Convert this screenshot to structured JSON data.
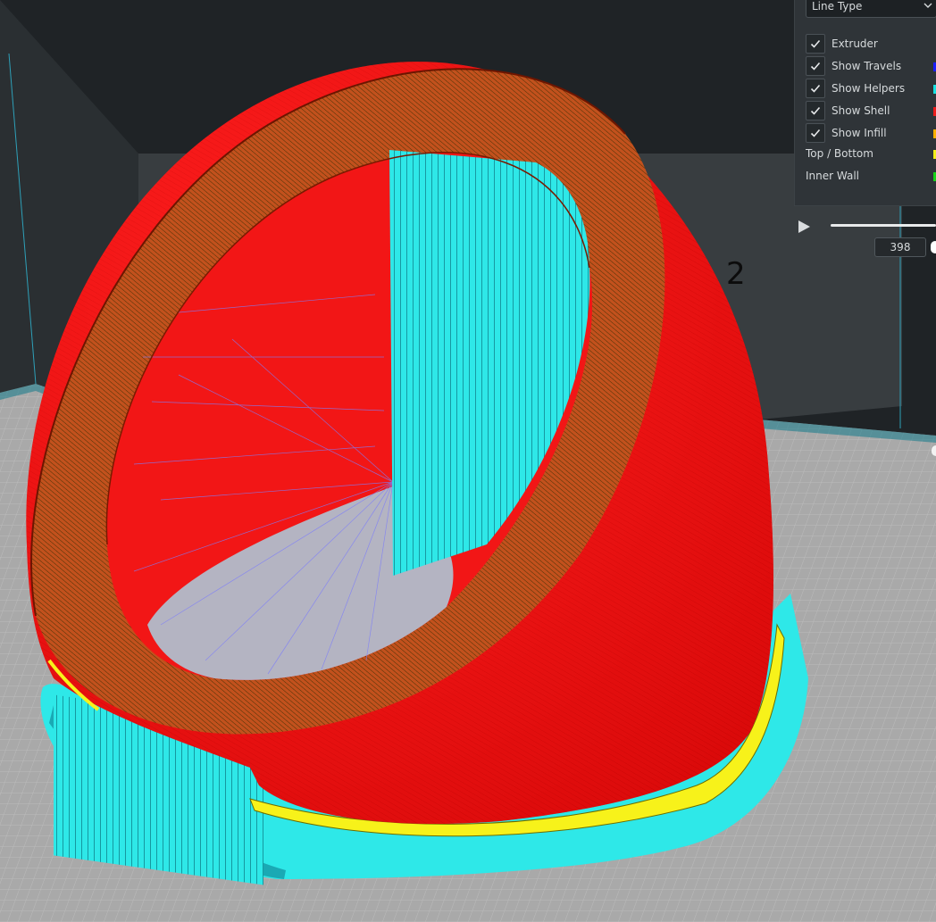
{
  "colors": {
    "background": "#1f2326",
    "build_plate": "#a8a8a8",
    "shell": "#ff1a1a",
    "helpers": "#24e6e6",
    "travels": "#3b3bff",
    "infill": "#ffb000",
    "top_bottom": "#f7f21a",
    "inner_wall": "#16d116"
  },
  "viewport": {
    "object_label": "2"
  },
  "panel": {
    "view_select": "Line Type",
    "checkboxes": [
      {
        "label": "Extruder",
        "checked": true
      },
      {
        "label": "Show Travels",
        "checked": true,
        "color": "#1c1cff"
      },
      {
        "label": "Show Helpers",
        "checked": true,
        "color": "#19e0e0"
      },
      {
        "label": "Show Shell",
        "checked": true,
        "color": "#ee1c1c"
      },
      {
        "label": "Show Infill",
        "checked": true,
        "color": "#ffb000"
      }
    ],
    "legend": [
      {
        "label": "Top / Bottom",
        "color": "#f3ee1a"
      },
      {
        "label": "Inner Wall",
        "color": "#18d318"
      }
    ]
  },
  "layer_slider": {
    "layer_value": "398"
  }
}
